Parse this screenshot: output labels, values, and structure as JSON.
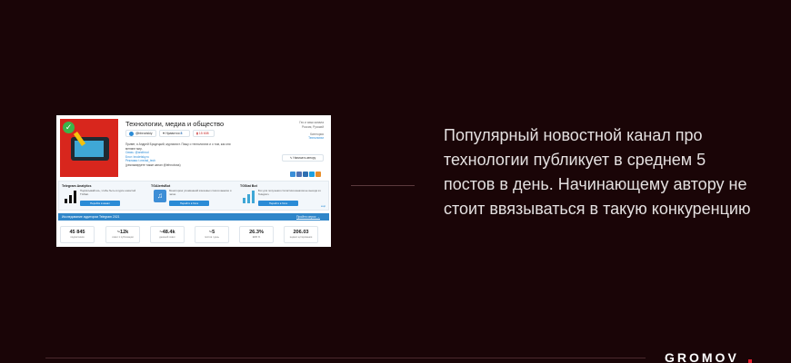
{
  "screenshot": {
    "channel_title": "Технологии, медиа и общество",
    "username": "@bbrodskiy",
    "favorites_label": "Нравится",
    "favorites_count": "8",
    "rank": "15 608",
    "description": "Привет, я Андрей Бродецкий, журналист. Пишу о технологиях и о том, как они меняют мир.",
    "contacts": [
      "Связь: @andbrod",
      "Блог: brodetsky.ru",
      "Реклама: t.me/ad_tech"
    ],
    "description_more": "(рекламируете также канал @tehnoboss)",
    "side_country_label": "Гео и язык канала",
    "side_country": "Россия, Русский",
    "side_category_label": "Категория",
    "side_category": "Технологии",
    "write_button": "Написать автору",
    "share_colors": [
      "#3b8ed8",
      "#4f73b5",
      "#2f6fb1",
      "#1e9fe0",
      "#e88d2a"
    ],
    "cards": [
      {
        "title": "Telegram Analytics",
        "desc": "Подписывайтесь, чтобы быть в курсе новостей TGStat.",
        "button": "Перейти в канал"
      },
      {
        "title": "TGAlertsBot",
        "desc": "Мониторинг упоминаний ключевых слов в каналах и чатах.",
        "button": "Перейти в бота"
      },
      {
        "title": "TGStat Bot",
        "desc": "Бот для получения статистики каналов не выходя из Telegram.",
        "button": "Перейти в бота"
      }
    ],
    "cards_more": "ещё",
    "research_text": "Исследование аудитории Telegram 2021",
    "research_link": "Пройти опрос →",
    "stats": [
      {
        "value": "45 845",
        "label": "подписчиков"
      },
      {
        "value": "~12k",
        "label": "охват 1 публикации"
      },
      {
        "value": "~48.4k",
        "label": "дневной охват"
      },
      {
        "value": "~5",
        "label": "постов / день"
      },
      {
        "value": "26.3%",
        "label": "ERR %"
      },
      {
        "value": "206.03",
        "label": "индекс цитирования"
      }
    ]
  },
  "caption": "Популярный новостной канал про технологии публикует в среднем 5 постов в день. Начинающему автору не стоит ввязываться в такую конкуренцию",
  "logo": "GROMOV",
  "colors": {
    "background": "#1a0507",
    "accent": "#e11d2b",
    "primary_blue": "#2f86c9"
  }
}
